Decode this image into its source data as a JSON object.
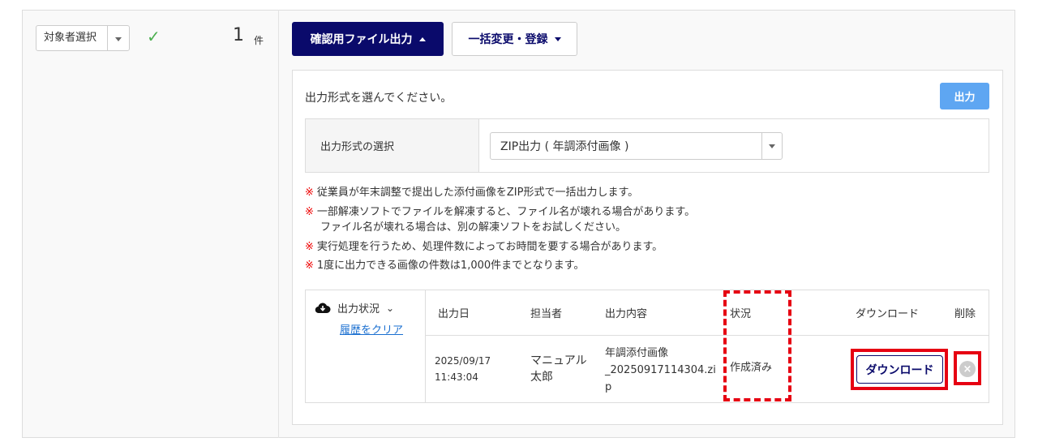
{
  "toolbar": {
    "target_select": "対象者選択",
    "count": "1",
    "count_unit": "件",
    "confirm_file_output": "確認用ファイル出力",
    "bulk_change": "一括変更・登録"
  },
  "panel": {
    "prompt": "出力形式を選んでください。",
    "output_button": "出力",
    "format_label": "出力形式の選択",
    "format_value": "ZIP出力 ( 年調添付画像 )",
    "note_mark": "※",
    "notes": [
      "従業員が年末調整で提出した添付画像をZIP形式で一括出力します。",
      "一部解凍ソフトでファイルを解凍すると、ファイル名が壊れる場合があります。",
      "ファイル名が壊れる場合は、別の解凍ソフトをお試しください。",
      "実行処理を行うため、処理件数によってお時間を要する場合があります。",
      "1度に出力できる画像の件数は1,000件までとなります。"
    ]
  },
  "status": {
    "title": "出力状況",
    "clear_history": "履歴をクリア",
    "headers": [
      "出力日",
      "担当者",
      "出力内容",
      "状況",
      "ダウンロード",
      "削除"
    ],
    "rows": [
      {
        "date": "2025/09/17",
        "time": "11:43:04",
        "person_1": "マニュアル",
        "person_2": "太郎",
        "content_1": "年調添付画像",
        "content_2": "_20250917114304.zi",
        "content_3": "p",
        "state": "作成済み",
        "download": "ダウンロード",
        "delete": "×"
      }
    ]
  },
  "colors": {
    "navy": "#0a0a6b",
    "accent_blue": "#5ea6f2",
    "highlight_red": "#e60012"
  }
}
